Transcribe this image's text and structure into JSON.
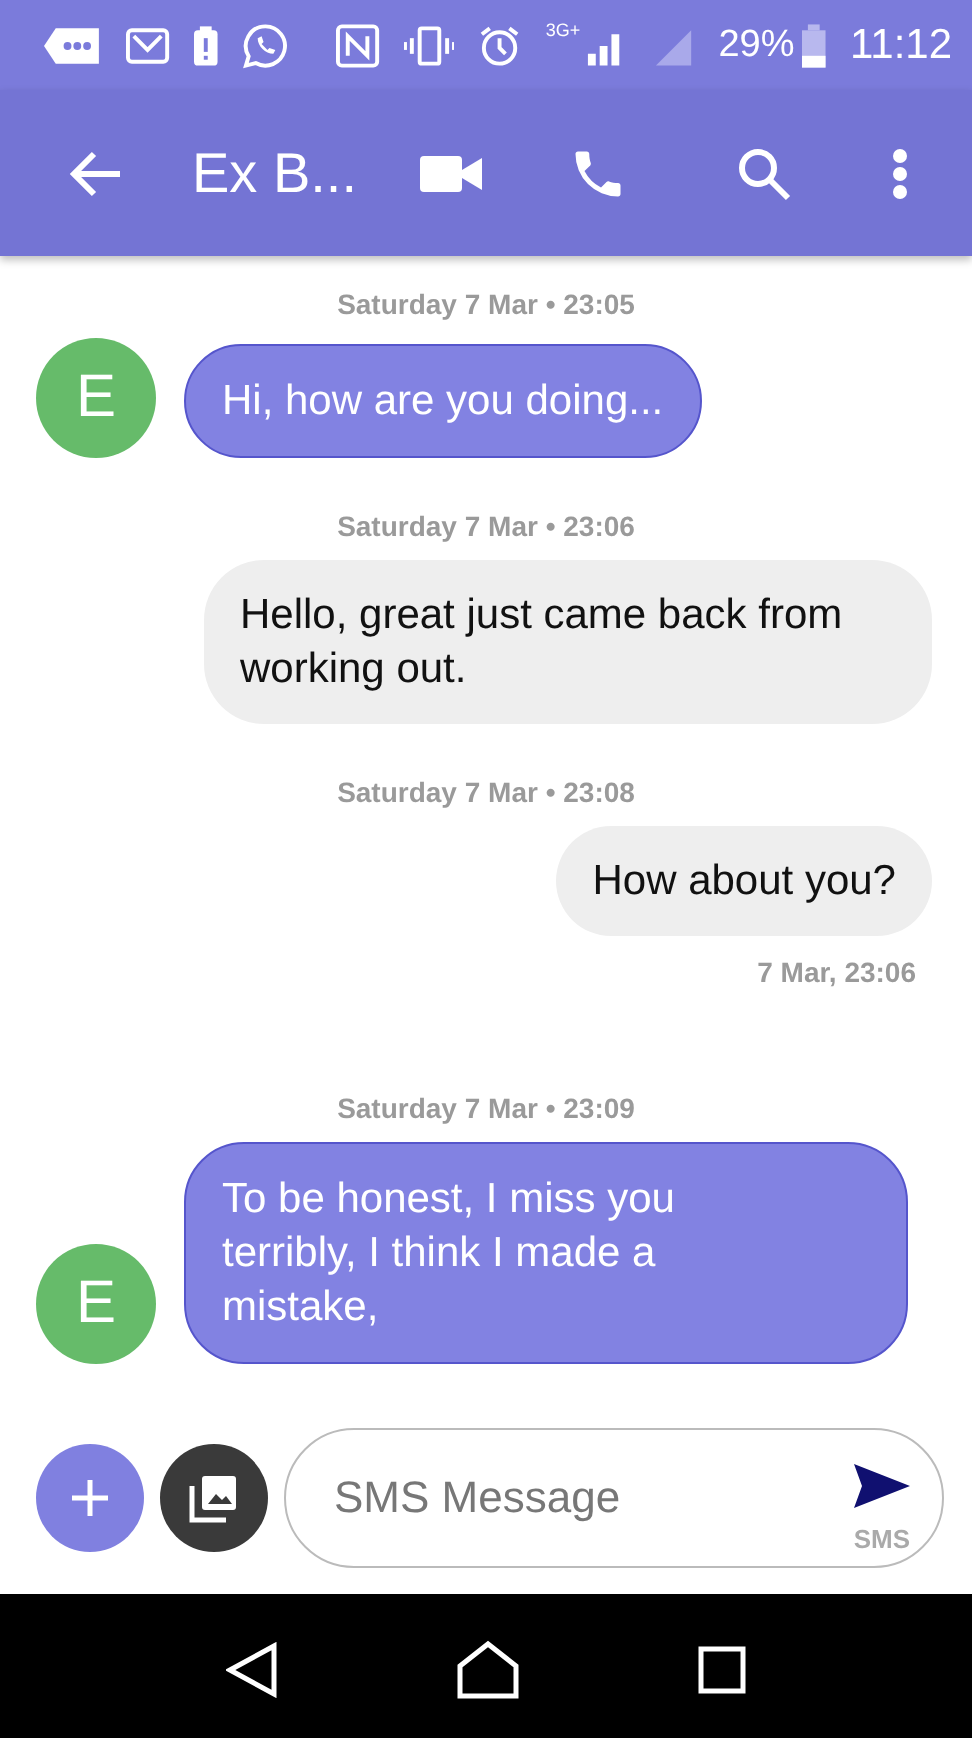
{
  "status_bar": {
    "network": "3G+",
    "battery": "29%",
    "time": "11:12"
  },
  "app_bar": {
    "title": "Ex B..."
  },
  "messages": [
    {
      "date": "Saturday 7 Mar • 23:05",
      "kind": "incoming",
      "avatar": "E",
      "color": "#66bb6a",
      "text": "Hi, how are you doing..."
    },
    {
      "date": "Saturday 7 Mar • 23:06",
      "kind": "outgoing",
      "text": "Hello, great just came back from working out."
    },
    {
      "date": "Saturday 7 Mar • 23:08",
      "kind": "outgoing",
      "text": "How about you?",
      "sent": "7 Mar, 23:06"
    },
    {
      "date": "Saturday 7 Mar • 23:09",
      "kind": "incoming",
      "avatar": "E",
      "color": "#66bb6a",
      "text": "To be honest, I miss you terribly, I think I made a mistake,"
    }
  ],
  "composer": {
    "placeholder": "SMS Message",
    "send_label": "SMS"
  }
}
